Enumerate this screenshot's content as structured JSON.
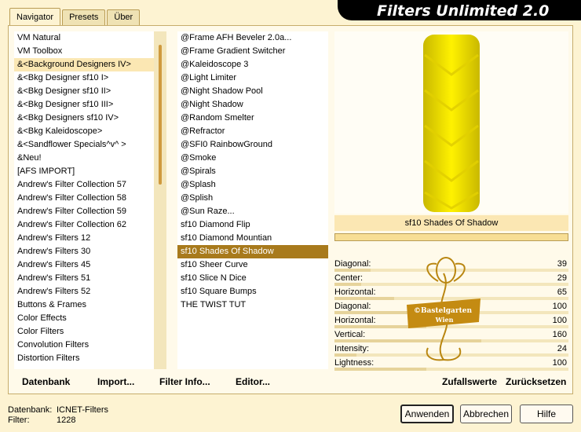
{
  "app_title": "Filters Unlimited 2.0",
  "tabs": [
    "Navigator",
    "Presets",
    "Über"
  ],
  "categories": [
    "VM Natural",
    "VM Toolbox",
    "&<Background Designers IV>",
    "&<Bkg Designer sf10 I>",
    "&<Bkg Designer sf10 II>",
    "&<Bkg Designer sf10 III>",
    "&<Bkg Designers sf10 IV>",
    "&<Bkg Kaleidoscope>",
    "&<Sandflower Specials^v^ >",
    "&Neu!",
    "[AFS IMPORT]",
    "Andrew's Filter Collection 57",
    "Andrew's Filter Collection 58",
    "Andrew's Filter Collection 59",
    "Andrew's Filter Collection 62",
    "Andrew's Filters 12",
    "Andrew's Filters 30",
    "Andrew's Filters 45",
    "Andrew's Filters 51",
    "Andrew's Filters 52",
    "Buttons & Frames",
    "Color Effects",
    "Color Filters",
    "Convolution Filters",
    "Distortion Filters"
  ],
  "filters": [
    "@Frame AFH Beveler 2.0a...",
    "@Frame Gradient Switcher",
    "@Kaleidoscope 3",
    "@Light Limiter",
    "@Night Shadow Pool",
    "@Night Shadow",
    "@Random Smelter",
    "@Refractor",
    "@SFI0 RainbowGround",
    "@Smoke",
    "@Spirals",
    "@Splash",
    "@Splish",
    "@Sun Raze...",
    "sf10 Diamond Flip",
    "sf10 Diamond Mountian",
    "sf10 Shades Of Shadow",
    "sf10 Sheer Curve",
    "sf10 Slice N Dice",
    "sf10 Square Bumps",
    "THE TWIST TUT"
  ],
  "selected_filter_name": "sf10 Shades Of Shadow",
  "params": [
    {
      "label": "Diagonal:",
      "value": "39",
      "level": 0.153
    },
    {
      "label": "Center:",
      "value": "29",
      "level": 0.114
    },
    {
      "label": "Horizontal:",
      "value": "65",
      "level": 0.255
    },
    {
      "label": "Diagonal:",
      "value": "100",
      "level": 0.392
    },
    {
      "label": "Horizontal:",
      "value": "100",
      "level": 0.392
    },
    {
      "label": "Vertical:",
      "value": "160",
      "level": 0.627
    },
    {
      "label": "Intensity:",
      "value": "24",
      "level": 0.094
    },
    {
      "label": "Lightness:",
      "value": "100",
      "level": 0.392
    }
  ],
  "watermark": {
    "line1": "©Bastelgarten",
    "line2": "Wien"
  },
  "bottom_left_buttons": {
    "database": "Datenbank",
    "import": "Import...",
    "filter_info": "Filter Info...",
    "editor": "Editor..."
  },
  "bottom_right_buttons": {
    "random": "Zufallswerte",
    "reset": "Zurücksetzen"
  },
  "status": {
    "database_label": "Datenbank:",
    "database_value": "ICNET-Filters",
    "filter_label": "Filter:",
    "filter_value": "1228"
  },
  "dialog_buttons": {
    "apply": "Anwenden",
    "cancel": "Abbrechen",
    "help": "Hilfe"
  },
  "colors": {
    "accent": "#a87a1c",
    "background": "#fdf3d2",
    "preview_yellow": "#f2e100"
  }
}
